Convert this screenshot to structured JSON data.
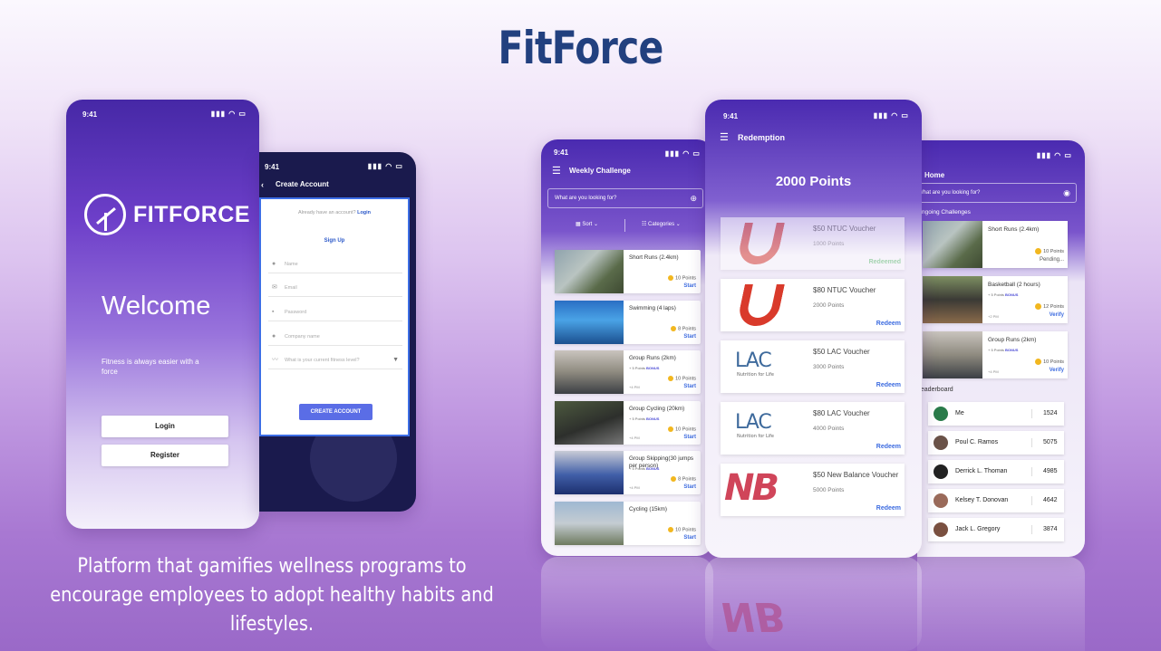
{
  "title": "FitForce",
  "tagline": "Platform that gamifies wellness programs to encourage employees to adopt healthy habits and lifestyles.",
  "status": {
    "time": "9:41",
    "icons": "▮▮▮ ◠ ▭"
  },
  "welcome": {
    "brand": "FITFORCE",
    "heading": "Welcome",
    "subtitle": "Fitness is always easier with a force",
    "login": "Login",
    "register": "Register"
  },
  "create": {
    "title": "Create Account",
    "question": "Already have an account?",
    "login_link": "Login",
    "signup": "Sign Up",
    "fields": [
      "Name",
      "Email",
      "Password",
      "Company name",
      "What is your current fitness level?"
    ],
    "button": "CREATE ACCOUNT"
  },
  "weekly": {
    "title": "Weekly Challenge",
    "search": "What are you looking for?",
    "sort": "Sort",
    "categories": "Categories",
    "challenges": [
      {
        "name": "Short Runs (2.4km)",
        "points": "10 Points",
        "action": "Start"
      },
      {
        "name": "Swimming (4 laps)",
        "points": "8 Points",
        "action": "Start"
      },
      {
        "name": "Group Runs (2km)",
        "bonus": "+ 5 Points",
        "bonus_tag": "BONUS",
        "points": "10 Points",
        "action": "Start",
        "pm": "+4 PM"
      },
      {
        "name": "Group Cycling (20km)",
        "bonus": "+ 5 Points",
        "bonus_tag": "BONUS",
        "points": "10 Points",
        "action": "Start",
        "pm": "+4 PM"
      },
      {
        "name": "Group Skipping(30 jumps per person)",
        "bonus": "+ 5 Points",
        "bonus_tag": "BONUS",
        "points": "8 Points",
        "action": "Start",
        "pm": "+4 PM"
      },
      {
        "name": "Cycling (15km)",
        "points": "10 Points",
        "action": "Start"
      }
    ]
  },
  "redeem": {
    "title": "Redemption",
    "points": "2000 Points",
    "vouchers": [
      {
        "name": "$50 NTUC Voucher",
        "cost": "1000 Points",
        "action": "Redeemed"
      },
      {
        "name": "$80 NTUC Voucher",
        "cost": "2000 Points",
        "action": "Redeem"
      },
      {
        "name": "$50 LAC Voucher",
        "cost": "3000 Points",
        "action": "Redeem"
      },
      {
        "name": "$80 LAC Voucher",
        "cost": "4000 Points",
        "action": "Redeem"
      },
      {
        "name": "$50 New Balance Voucher",
        "cost": "5000 Points",
        "action": "Redeem"
      }
    ],
    "lac_logo": "LAC",
    "lac_sub": "Nutrition for Life",
    "nb_logo": "NB"
  },
  "home": {
    "title": "Home",
    "search": "What are you looking for?",
    "ongoing": "Ongoing Challenges",
    "challenges": [
      {
        "name": "Short Runs (2.4km)",
        "points": "10 Points",
        "action": "Pending..."
      },
      {
        "name": "Basketball (2 hours)",
        "bonus": "+ 5 Points",
        "bonus_tag": "BONUS",
        "points": "12 Points",
        "action": "Verify",
        "pm": "+2 PM"
      },
      {
        "name": "Group Runs (2km)",
        "bonus": "+ 5 Points",
        "bonus_tag": "BONUS",
        "points": "10 Points",
        "action": "Verify",
        "pm": "+4 PM"
      }
    ],
    "leaderboard_title": "Leaderboard",
    "leaderboard": [
      {
        "name": "Me",
        "score": "1524"
      },
      {
        "name": "Poul C. Ramos",
        "score": "5075"
      },
      {
        "name": "Derrick L. Thoman",
        "score": "4985"
      },
      {
        "name": "Kelsey T. Donovan",
        "score": "4642"
      },
      {
        "name": "Jack L. Gregory",
        "score": "3874"
      }
    ]
  },
  "colors": {
    "title": "#22407f",
    "primary": "#4a2ab0",
    "accent": "#3c6be0",
    "coin": "#f2b71f"
  }
}
